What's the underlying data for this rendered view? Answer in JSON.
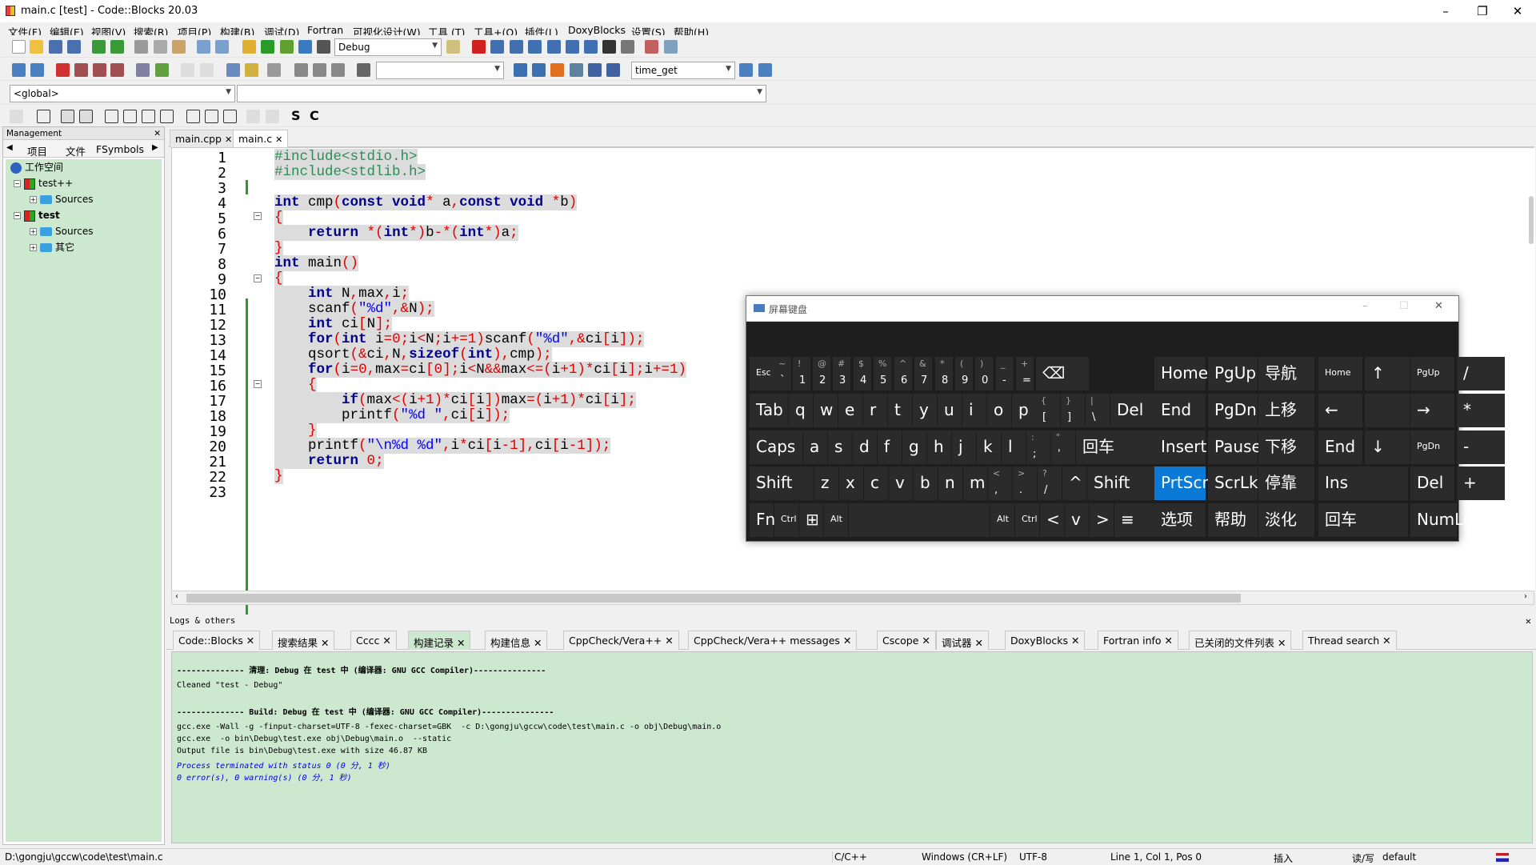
{
  "window": {
    "title": "main.c [test] - Code::Blocks 20.03",
    "minimize": "–",
    "maximize": "❐",
    "close": "✕"
  },
  "menu": [
    "文件(F)",
    "编辑(E)",
    "视图(V)",
    "搜索(R)",
    "项目(P)",
    "构建(B)",
    "调试(D)",
    "Fortran",
    "可视化设计(W)",
    "工具 (T)",
    "工具+(O)",
    "插件(L)",
    "DoxyBlocks",
    "设置(S)",
    "帮助(H)"
  ],
  "toolbar": {
    "build_target": "Debug",
    "search_combo": "",
    "func_combo": "time_get",
    "scope_global": "<global>",
    "scope_symbol": "",
    "s_label": "S",
    "c_label": "C"
  },
  "management": {
    "title": "Management",
    "tabs": [
      "项目",
      "文件",
      "FSymbols"
    ],
    "tree": [
      {
        "label": "工作空间"
      },
      {
        "label": "test++"
      },
      {
        "label": "Sources"
      },
      {
        "label": "test"
      },
      {
        "label": "Sources"
      },
      {
        "label": "其它"
      }
    ]
  },
  "editor": {
    "tabs": [
      "main.cpp",
      "main.c"
    ],
    "active_tab": "main.c",
    "line_numbers": [
      "1",
      "2",
      "3",
      "4",
      "5",
      "6",
      "7",
      "8",
      "9",
      "10",
      "11",
      "12",
      "13",
      "14",
      "15",
      "16",
      "17",
      "18",
      "19",
      "20",
      "21",
      "22",
      "23"
    ]
  },
  "logs": {
    "title": "Logs & others",
    "tabs": [
      "Code::Blocks",
      "搜索结果",
      "Cccc",
      "构建记录",
      "构建信息",
      "CppCheck/Vera++",
      "CppCheck/Vera++ messages",
      "Cscope",
      "调试器",
      "DoxyBlocks",
      "Fortran info",
      "已关闭的文件列表",
      "Thread search"
    ],
    "lines": [
      "-------------- 清理: Debug 在 test 中 (编译器: GNU GCC Compiler)---------------",
      "Cleaned \"test - Debug\"",
      "-------------- Build: Debug 在 test 中 (编译器: GNU GCC Compiler)---------------",
      "gcc.exe -Wall -g -finput-charset=UTF-8 -fexec-charset=GBK  -c D:\\gongju\\gccw\\code\\test\\main.c -o obj\\Debug\\main.o",
      "gcc.exe  -o bin\\Debug\\test.exe obj\\Debug\\main.o  --static",
      "Output file is bin\\Debug\\test.exe with size 46.87 KB",
      "Process terminated with status 0 (0 分, 1 秒)",
      "0 error(s), 0 warning(s) (0 分, 1 秒)"
    ]
  },
  "status": {
    "path": "D:\\gongju\\gccw\\code\\test\\main.c",
    "lang": "C/C++",
    "eol": "Windows (CR+LF)",
    "enc": "UTF-8",
    "pos": "Line 1, Col 1, Pos 0",
    "mode": "插入",
    "rw": "读/写",
    "profile": "default"
  },
  "osk": {
    "title": "屏幕键盘",
    "keys": {
      "esc": "Esc",
      "tilde": "~",
      "tilde2": "`",
      "k1s": "!",
      "k1": "1",
      "k2s": "@",
      "k2": "2",
      "k3s": "#",
      "k3": "3",
      "k4s": "$",
      "k4": "4",
      "k5s": "%",
      "k5": "5",
      "k6s": "^",
      "k6": "6",
      "k7s": "&",
      "k7": "7",
      "k8s": "*",
      "k8": "8",
      "k9s": "(",
      "k9": "9",
      "k0s": ")",
      "k0": "0",
      "minus_s": "_",
      "minus": "-",
      "eq_s": "+",
      "eq": "=",
      "bksp": "⌫",
      "home": "Home",
      "pgup": "PgUp",
      "nav": "导航",
      "nhome": "Home",
      "nup": "↑",
      "npgup": "PgUp",
      "ndiv": "/",
      "tab": "Tab",
      "q": "q",
      "w": "w",
      "e": "e",
      "r": "r",
      "t": "t",
      "y": "y",
      "u": "u",
      "i": "i",
      "o": "o",
      "p": "p",
      "lb_s": "{",
      "lb": "[",
      "rb_s": "}",
      "rb": "]",
      "bs_s": "|",
      "bs": "\\",
      "del": "Del",
      "end": "End",
      "pgdn": "PgDn",
      "moveup": "上移",
      "nleft": "←",
      "nright": "→",
      "nmul": "*",
      "caps": "Caps",
      "a": "a",
      "s": "s",
      "d": "d",
      "f": "f",
      "g": "g",
      "h": "h",
      "j": "j",
      "k": "k",
      "l": "l",
      "sc_s": ":",
      "sc": ";",
      "qt_s": "\"",
      "qt": "'",
      "enter": "回车",
      "insert": "Insert",
      "pause": "Pause",
      "movedown": "下移",
      "nend": "End",
      "ndown": "↓",
      "npgdn": "PgDn",
      "nminus": "-",
      "shift": "Shift",
      "z": "z",
      "x": "x",
      "c": "c",
      "v": "v",
      "b": "b",
      "n": "n",
      "m": "m",
      "cm_s": "<",
      "cm": ",",
      "pd_s": ">",
      "pd": ".",
      "sl_s": "?",
      "sl": "/",
      "up": "^",
      "rshift": "Shift",
      "prtscn": "PrtScn",
      "scrlk": "ScrLk",
      "dock": "停靠",
      "nins": "Ins",
      "ndel": "Del",
      "nplus": "+",
      "fn": "Fn",
      "ctrl": "Ctrl",
      "win": "⊞",
      "alt": "Alt",
      "ralt": "Alt",
      "rctrl": "Ctrl",
      "left": "<",
      "down": "v",
      "right": ">",
      "menu": "≡",
      "options": "选项",
      "help": "帮助",
      "fade": "淡化",
      "nenter": "回车",
      "numlock": "NumLock"
    }
  }
}
